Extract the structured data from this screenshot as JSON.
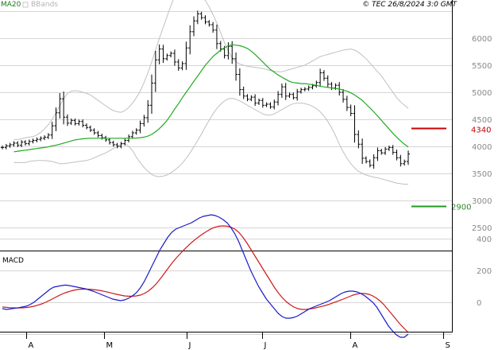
{
  "header": {
    "legend_ma": "MA20",
    "legend_bb": "BBands",
    "copyright": "© TEC 26/8/2024 3:0 GMT"
  },
  "macd_panel": {
    "title": "MACD"
  },
  "colors": {
    "price": "#000000",
    "ma20": "#22aa22",
    "bbands": "#c0c0c0",
    "resistance": "#cc0000",
    "support": "#229922",
    "macd": "#1a1acc",
    "signal": "#cc1a1a",
    "grid": "#d6d6d6"
  },
  "chart_data": [
    {
      "type": "line",
      "subtype": "ohlc-bars-with-overlays",
      "x_months": [
        "A",
        "M",
        "J",
        "J",
        "A",
        "S"
      ],
      "y_ticks": [
        2500,
        3000,
        3500,
        4000,
        4500,
        5000,
        5500,
        6000
      ],
      "ylim": [
        2000,
        6500
      ],
      "grid": true,
      "levels": [
        {
          "label": "4340",
          "value": 4340,
          "kind": "resistance"
        },
        {
          "label": "2900",
          "value": 2900,
          "kind": "support"
        }
      ],
      "price_close": [
        3980,
        4010,
        4030,
        4060,
        4020,
        4080,
        4050,
        4090,
        4110,
        4130,
        4150,
        4170,
        4210,
        4380,
        4620,
        4880,
        4540,
        4430,
        4480,
        4420,
        4460,
        4390,
        4350,
        4300,
        4250,
        4200,
        4160,
        4120,
        4070,
        4030,
        4000,
        4050,
        4110,
        4180,
        4250,
        4300,
        4420,
        4530,
        4760,
        5170,
        5600,
        5800,
        5620,
        5680,
        5720,
        5560,
        5450,
        5530,
        5820,
        6120,
        6320,
        6450,
        6380,
        6300,
        6250,
        6150,
        5900,
        5800,
        5680,
        5850,
        5620,
        5330,
        5050,
        4930,
        4870,
        4910,
        4800,
        4850,
        4760,
        4780,
        4730,
        4820,
        4960,
        5100,
        4930,
        4960,
        4900,
        5010,
        5050,
        5060,
        5090,
        5120,
        5180,
        5360,
        5260,
        5150,
        5080,
        5130,
        5000,
        4870,
        4720,
        4610,
        4220,
        4040,
        3780,
        3720,
        3650,
        3790,
        3920,
        3880,
        3950,
        3980,
        3890,
        3790,
        3680,
        3720,
        3860
      ],
      "ma20": [
        3900,
        3910,
        3920,
        3930,
        3940,
        3950,
        3960,
        3970,
        3980,
        3990,
        4010,
        4020,
        4040,
        4060,
        4080,
        4100,
        4120,
        4130,
        4140,
        4145,
        4150,
        4150,
        4150,
        4150,
        4150,
        4150,
        4150,
        4150,
        4150,
        4150,
        4150,
        4150,
        4155,
        4160,
        4170,
        4190,
        4220,
        4270,
        4330,
        4400,
        4480,
        4580,
        4690,
        4790,
        4900,
        5000,
        5100,
        5200,
        5300,
        5400,
        5500,
        5580,
        5660,
        5720,
        5780,
        5820,
        5860,
        5880,
        5870,
        5860,
        5840,
        5810,
        5760,
        5700,
        5630,
        5560,
        5490,
        5420,
        5370,
        5320,
        5280,
        5240,
        5200,
        5180,
        5170,
        5160,
        5160,
        5150,
        5140,
        5130,
        5110,
        5100,
        5090,
        5080,
        5070,
        5060,
        5040,
        5020,
        4990,
        4950,
        4900,
        4850,
        4780,
        4710,
        4640,
        4560,
        4480,
        4400,
        4320,
        4240,
        4170,
        4100,
        4040,
        3990
      ],
      "bb_upper": [
        4120,
        4130,
        4140,
        4160,
        4170,
        4180,
        4210,
        4260,
        4320,
        4400,
        4500,
        4620,
        4750,
        4880,
        4980,
        5020,
        5030,
        5020,
        5000,
        4980,
        4950,
        4900,
        4850,
        4800,
        4750,
        4700,
        4660,
        4640,
        4630,
        4660,
        4720,
        4800,
        4900,
        5020,
        5180,
        5360,
        5560,
        5780,
        6000,
        6200,
        6400,
        6600,
        6780,
        6900,
        6980,
        7000,
        6980,
        6940,
        6880,
        6800,
        6700,
        6580,
        6440,
        6280,
        6100,
        5920,
        5760,
        5640,
        5560,
        5520,
        5500,
        5480,
        5470,
        5460,
        5450,
        5440,
        5420,
        5400,
        5390,
        5380,
        5380,
        5400,
        5420,
        5440,
        5460,
        5480,
        5500,
        5540,
        5580,
        5620,
        5660,
        5680,
        5700,
        5720,
        5740,
        5760,
        5780,
        5790,
        5800,
        5780,
        5740,
        5680,
        5620,
        5540,
        5460,
        5380,
        5300,
        5200,
        5100,
        5000,
        4900,
        4820,
        4760,
        4700
      ],
      "bb_lower": [
        3700,
        3700,
        3700,
        3700,
        3720,
        3730,
        3740,
        3740,
        3740,
        3730,
        3720,
        3700,
        3680,
        3680,
        3690,
        3700,
        3710,
        3720,
        3730,
        3740,
        3760,
        3790,
        3820,
        3850,
        3880,
        3920,
        3960,
        4000,
        4040,
        4050,
        4000,
        3920,
        3800,
        3700,
        3610,
        3540,
        3480,
        3450,
        3440,
        3450,
        3470,
        3510,
        3560,
        3620,
        3690,
        3780,
        3880,
        3990,
        4110,
        4230,
        4360,
        4480,
        4600,
        4700,
        4780,
        4840,
        4880,
        4890,
        4870,
        4840,
        4800,
        4760,
        4720,
        4680,
        4640,
        4600,
        4580,
        4580,
        4600,
        4640,
        4680,
        4720,
        4760,
        4790,
        4800,
        4800,
        4790,
        4770,
        4740,
        4700,
        4640,
        4560,
        4460,
        4340,
        4200,
        4040,
        3900,
        3780,
        3680,
        3600,
        3540,
        3500,
        3470,
        3450,
        3430,
        3420,
        3400,
        3380,
        3360,
        3340,
        3320,
        3310,
        3300,
        3300
      ]
    },
    {
      "type": "line",
      "title": "MACD",
      "y_ticks": [
        0,
        200,
        400
      ],
      "ylim": [
        -300,
        600
      ],
      "grid": true,
      "series": [
        {
          "values": [
            -40,
            -45,
            -42,
            -38,
            -35,
            -30,
            -25,
            -15,
            0,
            20,
            40,
            60,
            80,
            95,
            100,
            105,
            108,
            105,
            100,
            95,
            90,
            85,
            78,
            70,
            60,
            50,
            40,
            30,
            20,
            15,
            10,
            15,
            25,
            40,
            60,
            90,
            130,
            180,
            230,
            280,
            330,
            370,
            410,
            440,
            460,
            470,
            480,
            490,
            500,
            515,
            530,
            540,
            545,
            550,
            545,
            535,
            520,
            500,
            470,
            430,
            380,
            320,
            260,
            200,
            150,
            100,
            60,
            20,
            -10,
            -40,
            -70,
            -90,
            -100,
            -100,
            -95,
            -85,
            -70,
            -55,
            -40,
            -30,
            -20,
            -10,
            0,
            10,
            25,
            40,
            55,
            65,
            70,
            70,
            65,
            55,
            40,
            20,
            0,
            -30,
            -70,
            -110,
            -150,
            -180,
            -205,
            -220,
            -220,
            -200
          ]
        },
        {
          "values": [
            -30,
            -32,
            -34,
            -35,
            -36,
            -35,
            -33,
            -30,
            -25,
            -18,
            -10,
            0,
            12,
            25,
            38,
            50,
            60,
            68,
            75,
            80,
            82,
            83,
            82,
            80,
            77,
            73,
            68,
            62,
            56,
            50,
            45,
            40,
            38,
            38,
            40,
            45,
            55,
            70,
            90,
            115,
            145,
            178,
            212,
            245,
            275,
            302,
            328,
            352,
            375,
            396,
            415,
            432,
            448,
            462,
            472,
            478,
            480,
            478,
            472,
            460,
            440,
            410,
            375,
            335,
            295,
            255,
            215,
            175,
            135,
            95,
            60,
            30,
            5,
            -15,
            -30,
            -40,
            -45,
            -45,
            -42,
            -38,
            -32,
            -26,
            -20,
            -12,
            -3,
            6,
            15,
            25,
            35,
            45,
            52,
            56,
            55,
            50,
            40,
            25,
            5,
            -20,
            -50,
            -80,
            -110,
            -140,
            -165,
            -190
          ]
        }
      ]
    }
  ]
}
